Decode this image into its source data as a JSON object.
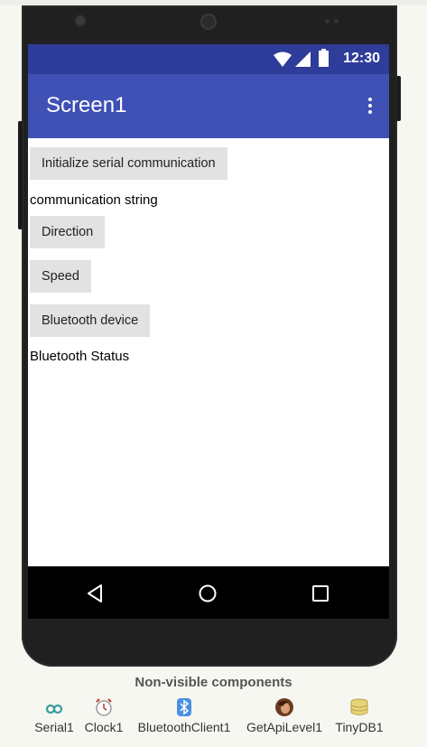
{
  "status_bar": {
    "time": "12:30",
    "icons": [
      "wifi-icon",
      "signal-icon",
      "battery-icon"
    ]
  },
  "app_bar": {
    "title": "Screen1",
    "menu_icon": "overflow-menu-icon"
  },
  "content": {
    "init_button": "Initialize serial communication",
    "comm_label": "communication string",
    "direction_button": "Direction",
    "speed_button": "Speed",
    "bt_device_button": "Bluetooth device",
    "bt_status_label": "Bluetooth Status"
  },
  "nav_bar": {
    "icons": [
      "back-icon",
      "home-icon",
      "recents-icon"
    ]
  },
  "non_visible": {
    "title": "Non-visible components",
    "items": [
      {
        "label": "Serial1",
        "icon": "arduino-icon"
      },
      {
        "label": "Clock1",
        "icon": "clock-icon"
      },
      {
        "label": "BluetoothClient1",
        "icon": "bluetooth-icon"
      },
      {
        "label": "GetApiLevel1",
        "icon": "avatar-icon"
      },
      {
        "label": "TinyDB1",
        "icon": "database-icon"
      }
    ]
  },
  "colors": {
    "status_bar": "#2e3c9a",
    "app_bar": "#3f51b5",
    "button": "#e2e2e2"
  }
}
